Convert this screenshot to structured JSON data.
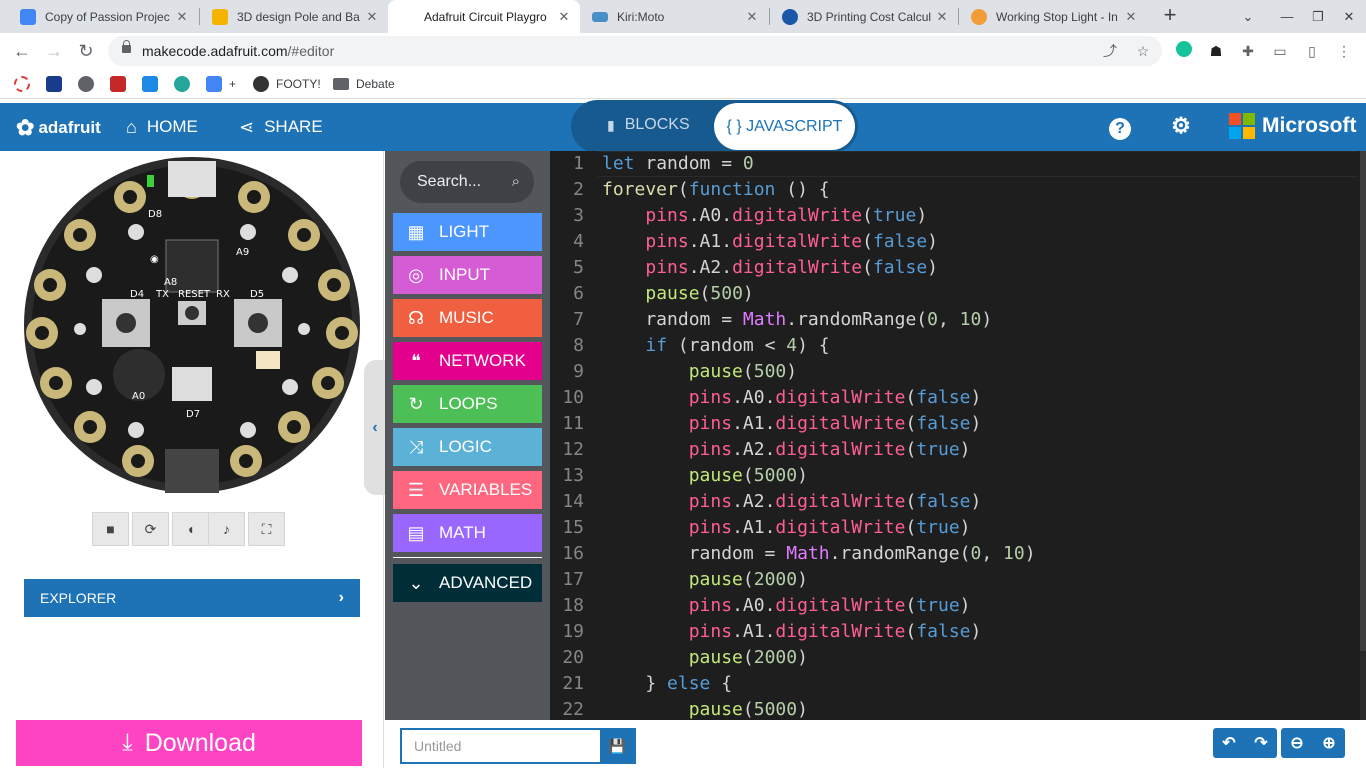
{
  "browser": {
    "tabs": [
      {
        "title": "Copy of Passion Projec",
        "color": "#4285f4"
      },
      {
        "title": "3D design Pole and Ba",
        "color": "#f4b400"
      },
      {
        "title": "Adafruit Circuit Playgro",
        "color": "#ffffff"
      },
      {
        "title": "Kiri:Moto",
        "color": "#4a90c8"
      },
      {
        "title": "3D Printing Cost Calcul",
        "color": "#1a57a8"
      },
      {
        "title": "Working Stop Light - In",
        "color": "#f29d38"
      }
    ],
    "url_host": "makecode.adafruit.com",
    "url_path": "/#editor",
    "bookmarks": [
      {
        "label": "",
        "color": "#e53935"
      },
      {
        "label": "",
        "color": "#1a3a8a"
      },
      {
        "label": "",
        "color": "#5f6368"
      },
      {
        "label": "",
        "color": "#c62828"
      },
      {
        "label": "",
        "color": "#1e88e5"
      },
      {
        "label": "",
        "color": "#26a69a"
      },
      {
        "label": "",
        "color": "#4285f4"
      },
      {
        "label": "+",
        "color": ""
      },
      {
        "label": "FOOTY!",
        "color": "#333333"
      },
      {
        "label": "Debate",
        "color": "#5f6368"
      }
    ]
  },
  "header": {
    "brand": "adafruit",
    "home": "HOME",
    "share": "SHARE",
    "blocks": "BLOCKS",
    "javascript": "{ } JAVASCRIPT",
    "microsoft": "Microsoft"
  },
  "simulator": {
    "explorer": "EXPLORER",
    "download": "Download"
  },
  "toolbox": {
    "search_placeholder": "Search...",
    "categories": [
      {
        "label": "LIGHT",
        "color": "#4c97ff",
        "icon": "grid-icon"
      },
      {
        "label": "INPUT",
        "color": "#d65cd6",
        "icon": "target-icon"
      },
      {
        "label": "MUSIC",
        "color": "#e63022",
        "icon": "headphones-icon"
      },
      {
        "label": "NETWORK",
        "color": "#e3008c",
        "icon": "chat-icon"
      },
      {
        "label": "LOOPS",
        "color": "#4cbf56",
        "icon": "refresh-icon"
      },
      {
        "label": "LOGIC",
        "color": "#5cb1d6",
        "icon": "shuffle-icon"
      },
      {
        "label": "VARIABLES",
        "color": "#ff6680",
        "icon": "list-icon"
      },
      {
        "label": "MATH",
        "color": "#9966ff",
        "icon": "calculator-icon"
      },
      {
        "label": "ADVANCED",
        "color": "#003a44",
        "icon": "chevron-down-icon"
      }
    ]
  },
  "code": {
    "lines": [
      "let random = 0",
      "forever(function () {",
      "    pins.A0.digitalWrite(true)",
      "    pins.A1.digitalWrite(false)",
      "    pins.A2.digitalWrite(false)",
      "    pause(500)",
      "    random = Math.randomRange(0, 10)",
      "    if (random < 4) {",
      "        pause(500)",
      "        pins.A0.digitalWrite(false)",
      "        pins.A1.digitalWrite(false)",
      "        pins.A2.digitalWrite(true)",
      "        pause(5000)",
      "        pins.A2.digitalWrite(false)",
      "        pins.A1.digitalWrite(true)",
      "        random = Math.randomRange(0, 10)",
      "        pause(2000)",
      "        pins.A0.digitalWrite(true)",
      "        pins.A1.digitalWrite(false)",
      "        pause(2000)",
      "    } else {",
      "        pause(5000)"
    ]
  },
  "footer": {
    "project_placeholder": "Untitled"
  }
}
